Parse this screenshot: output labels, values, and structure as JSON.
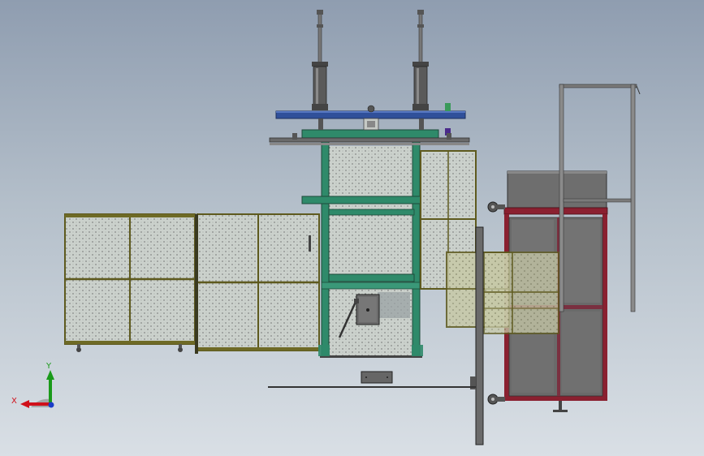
{
  "axes_triad": {
    "x_label": "X",
    "y_label": "Y",
    "x_color": "#d0101a",
    "y_color": "#1a9a1a",
    "z_color": "#1a3cc8"
  },
  "colors": {
    "steel_green": "#2f8a6a",
    "mesh_frame": "#5e5a1e",
    "mesh_fill": "#c9cfca",
    "top_beam_blue": "#30509a",
    "cart_frame": "#8a2030",
    "dark_gray": "#666666",
    "outline": "#222222"
  }
}
